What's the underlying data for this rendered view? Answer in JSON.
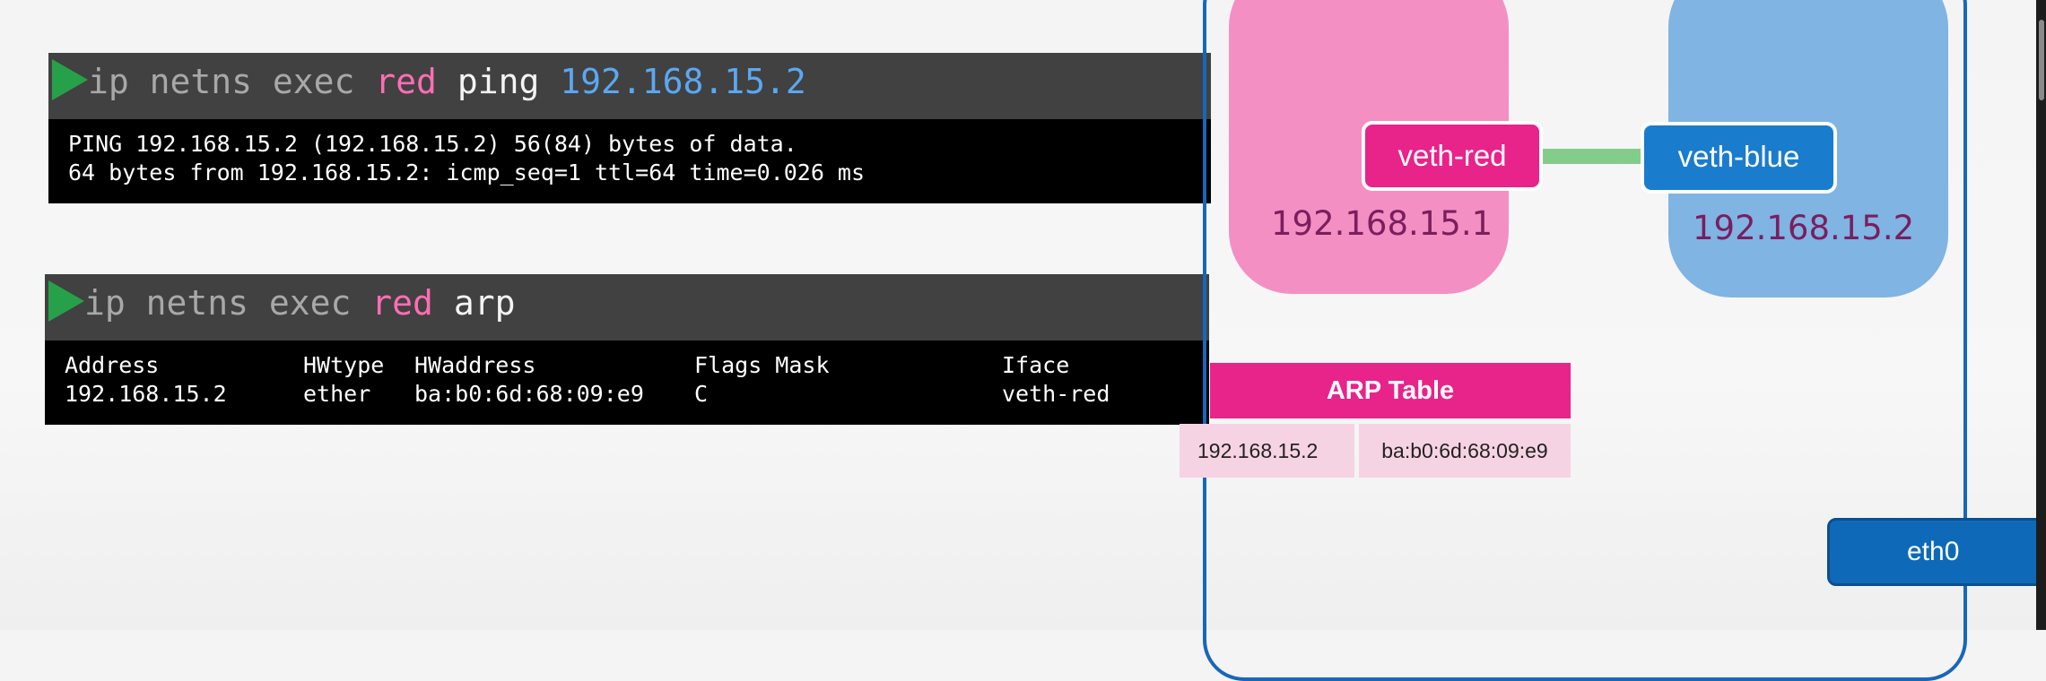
{
  "terminal1": {
    "cmd_ip": "ip netns exec ",
    "cmd_ns": "red",
    "cmd_ping": " ping ",
    "cmd_target": "192.168.15.2",
    "output": [
      "PING 192.168.15.2 (192.168.15.2) 56(84) bytes of data.",
      "64 bytes from 192.168.15.2: icmp_seq=1 ttl=64 time=0.026 ms"
    ]
  },
  "terminal2": {
    "cmd_ip": "ip netns exec ",
    "cmd_ns": "red",
    "cmd_rest": " arp",
    "headers": [
      "Address",
      "HWtype",
      "HWaddress",
      "Flags Mask",
      "Iface"
    ],
    "row": [
      "192.168.15.2",
      "ether",
      "ba:b0:6d:68:09:e9",
      "C",
      "veth-red"
    ]
  },
  "diagram": {
    "red_ns_ip": "192.168.15.1",
    "blue_ns_ip": "192.168.15.2",
    "veth_red": "veth-red",
    "veth_blue": "veth-blue",
    "arp_title": "ARP Table",
    "arp_ip": "192.168.15.2",
    "arp_mac": "ba:b0:6d:68:09:e9",
    "eth0": "eth0"
  },
  "colors": {
    "red_ns": "#f48fc3",
    "blue_ns": "#7fb4e3",
    "veth_red": "#e8238a",
    "veth_blue": "#1a7ccd",
    "link": "#84cc8c",
    "host_border": "#1867b8"
  }
}
